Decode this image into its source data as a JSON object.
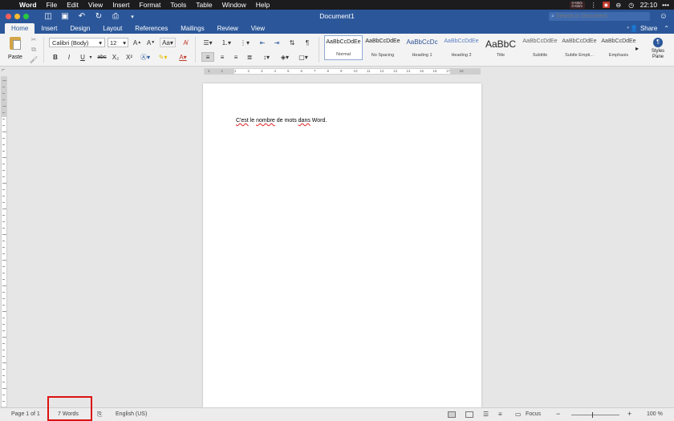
{
  "menubar": {
    "app": "Word",
    "items": [
      "File",
      "Edit",
      "View",
      "Insert",
      "Format",
      "Tools",
      "Table",
      "Window",
      "Help"
    ],
    "net_up": "0 KB/s",
    "net_down": "0 KB/s",
    "time": "22:10",
    "more": "•••"
  },
  "titlebar": {
    "doc_title": "Document1",
    "search_placeholder": "Search in Document"
  },
  "tabs": [
    "Home",
    "Insert",
    "Design",
    "Layout",
    "References",
    "Mailings",
    "Review",
    "View"
  ],
  "share_label": "Share",
  "ribbon": {
    "paste_label": "Paste",
    "font_name": "Calibri (Body)",
    "font_size": "12",
    "grow_font": "A",
    "shrink_font": "A",
    "case": "Aa",
    "bold": "B",
    "italic": "I",
    "underline": "U",
    "strike": "abc",
    "subscript": "X₂",
    "superscript": "X²",
    "pilcrow": "¶",
    "styles": [
      {
        "sample": "AaBbCcDdEe",
        "name": "Normal",
        "color": "#222222"
      },
      {
        "sample": "AaBbCcDdEe",
        "name": "No Spacing",
        "color": "#222222"
      },
      {
        "sample": "AaBbCcDc",
        "name": "Heading 1",
        "color": "#2f5597"
      },
      {
        "sample": "AaBbCcDdEe",
        "name": "Heading 2",
        "color": "#5b7fc4"
      },
      {
        "sample": "AaBbC",
        "name": "Title",
        "color": "#222222"
      },
      {
        "sample": "AaBbCcDdEe",
        "name": "Subtitle",
        "color": "#666666"
      },
      {
        "sample": "AaBbCcDdEe",
        "name": "Subtle Empti...",
        "color": "#555555"
      },
      {
        "sample": "AaBbCcDdEe",
        "name": "Emphasis",
        "color": "#444444"
      }
    ],
    "styles_pane_label": "Styles Pane"
  },
  "ruler": {
    "ticks": [
      "2",
      "1",
      "1",
      "2",
      "3",
      "4",
      "5",
      "6",
      "7",
      "8",
      "9",
      "10",
      "11",
      "12",
      "13",
      "14",
      "15",
      "16",
      "17",
      "18"
    ]
  },
  "document": {
    "words": [
      {
        "text": "C'est",
        "squiggle": true
      },
      {
        "text": "le",
        "squiggle": false
      },
      {
        "text": "nombre",
        "squiggle": true
      },
      {
        "text": "de",
        "squiggle": false
      },
      {
        "text": "mots",
        "squiggle": false
      },
      {
        "text": "dans",
        "squiggle": true
      },
      {
        "text": "Word.",
        "squiggle": false
      }
    ]
  },
  "status": {
    "page": "Page 1 of 1",
    "words": "7 Words",
    "language": "English (US)",
    "focus": "Focus",
    "zoom_minus": "−",
    "zoom_plus": "+",
    "zoom": "100 %"
  },
  "colors": {
    "word_blue": "#2b579a",
    "highlight_red": "#dd1111"
  }
}
